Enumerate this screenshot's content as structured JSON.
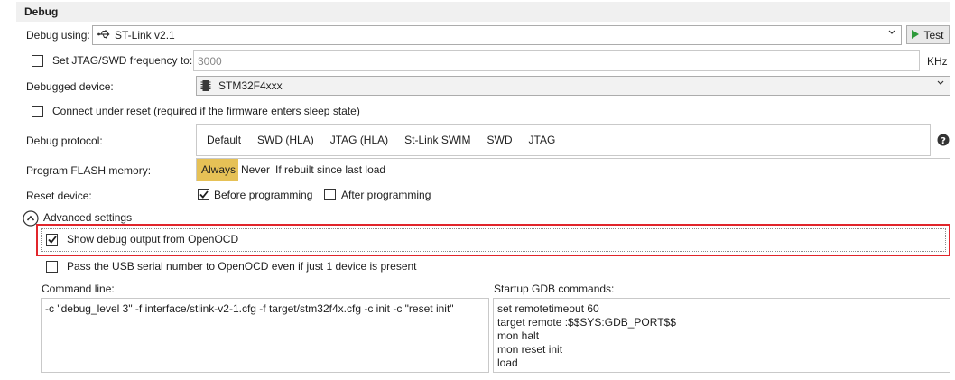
{
  "section": {
    "title": "Debug"
  },
  "debug_using": {
    "label": "Debug using:",
    "value": "ST-Link v2.1",
    "test_label": "Test"
  },
  "jtag_freq": {
    "checkbox_label": "Set JTAG/SWD frequency to:",
    "checked": false,
    "value": "3000",
    "unit": "KHz"
  },
  "debugged_device": {
    "label": "Debugged device:",
    "value": "STM32F4xxx"
  },
  "connect_reset": {
    "label": "Connect under reset (required if the firmware enters sleep state)",
    "checked": false
  },
  "debug_protocol": {
    "label": "Debug protocol:",
    "options": [
      "Default",
      "SWD (HLA)",
      "JTAG (HLA)",
      "St-Link SWIM",
      "SWD",
      "JTAG"
    ]
  },
  "program_flash": {
    "label": "Program FLASH memory:",
    "options": [
      "Always",
      "Never",
      "If rebuilt since last load"
    ],
    "selected": "Always"
  },
  "reset_device": {
    "label": "Reset device:",
    "before_label": "Before programming",
    "before_checked": true,
    "after_label": "After programming",
    "after_checked": false
  },
  "advanced": {
    "label": "Advanced settings",
    "show_output_label": "Show debug output from OpenOCD",
    "show_output_checked": true,
    "pass_usb_label": "Pass the USB serial number to OpenOCD even if just 1 device is present",
    "pass_usb_checked": false
  },
  "command_line": {
    "label": "Command line:",
    "value": "-c \"debug_level 3\" -f interface/stlink-v2-1.cfg -f target/stm32f4x.cfg -c init -c \"reset init\""
  },
  "startup_gdb": {
    "label": "Startup GDB commands:",
    "lines": [
      "set remotetimeout 60",
      "target remote :$$SYS:GDB_PORT$$",
      "mon halt",
      "mon reset init",
      "load"
    ]
  },
  "colors": {
    "selected_option": "#e6c156",
    "highlight_border": "#e1252b",
    "test_arrow": "#2e9a3a"
  },
  "icons": {
    "usb": "usb-icon",
    "chip": "chip-icon",
    "help": "help-icon",
    "collapse": "collapse-icon",
    "play": "play-icon"
  }
}
